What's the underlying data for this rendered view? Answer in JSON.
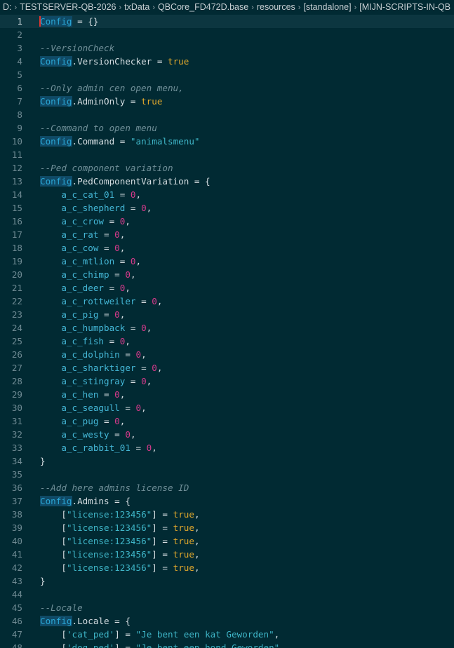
{
  "breadcrumb": [
    "D:",
    "TESTSERVER-QB-2026",
    "txData",
    "QBCore_FD472D.base",
    "resources",
    "[standalone]",
    "[MIJN-SCRIPTS-IN-QB"
  ],
  "editor": {
    "current_line": 1,
    "lines": [
      {
        "n": "1",
        "tokens": [
          [
            "config",
            "Config"
          ],
          [
            "op",
            " = {}"
          ]
        ]
      },
      {
        "n": "2",
        "tokens": []
      },
      {
        "n": "3",
        "tokens": [
          [
            "comment",
            "--VersionCheck"
          ]
        ]
      },
      {
        "n": "4",
        "tokens": [
          [
            "config",
            "Config"
          ],
          [
            "plain",
            ".VersionChecker "
          ],
          [
            "op",
            "= "
          ],
          [
            "bool",
            "true"
          ]
        ]
      },
      {
        "n": "5",
        "tokens": []
      },
      {
        "n": "6",
        "tokens": [
          [
            "comment",
            "--Only admin cen open menu,"
          ]
        ]
      },
      {
        "n": "7",
        "tokens": [
          [
            "config",
            "Config"
          ],
          [
            "plain",
            ".AdminOnly "
          ],
          [
            "op",
            "= "
          ],
          [
            "bool",
            "true"
          ]
        ]
      },
      {
        "n": "8",
        "tokens": []
      },
      {
        "n": "9",
        "tokens": [
          [
            "comment",
            "--Command to open menu"
          ]
        ]
      },
      {
        "n": "10",
        "tokens": [
          [
            "config",
            "Config"
          ],
          [
            "plain",
            ".Command "
          ],
          [
            "op",
            "= "
          ],
          [
            "string",
            "\"animalsmenu\""
          ]
        ]
      },
      {
        "n": "11",
        "tokens": []
      },
      {
        "n": "12",
        "tokens": [
          [
            "comment",
            "--Ped component variation"
          ]
        ]
      },
      {
        "n": "13",
        "tokens": [
          [
            "config",
            "Config"
          ],
          [
            "plain",
            ".PedComponentVariation "
          ],
          [
            "op",
            "= {"
          ]
        ]
      },
      {
        "n": "14",
        "tokens": [
          [
            "plain",
            "    "
          ],
          [
            "key",
            "a_c_cat_01"
          ],
          [
            "op",
            " = "
          ],
          [
            "number",
            "0"
          ],
          [
            "op",
            ","
          ]
        ]
      },
      {
        "n": "15",
        "tokens": [
          [
            "plain",
            "    "
          ],
          [
            "key",
            "a_c_shepherd"
          ],
          [
            "op",
            " = "
          ],
          [
            "number",
            "0"
          ],
          [
            "op",
            ","
          ]
        ]
      },
      {
        "n": "16",
        "tokens": [
          [
            "plain",
            "    "
          ],
          [
            "key",
            "a_c_crow"
          ],
          [
            "op",
            " = "
          ],
          [
            "number",
            "0"
          ],
          [
            "op",
            ","
          ]
        ]
      },
      {
        "n": "17",
        "tokens": [
          [
            "plain",
            "    "
          ],
          [
            "key",
            "a_c_rat"
          ],
          [
            "op",
            " = "
          ],
          [
            "number",
            "0"
          ],
          [
            "op",
            ","
          ]
        ]
      },
      {
        "n": "18",
        "tokens": [
          [
            "plain",
            "    "
          ],
          [
            "key",
            "a_c_cow"
          ],
          [
            "op",
            " = "
          ],
          [
            "number",
            "0"
          ],
          [
            "op",
            ","
          ]
        ]
      },
      {
        "n": "19",
        "tokens": [
          [
            "plain",
            "    "
          ],
          [
            "key",
            "a_c_mtlion"
          ],
          [
            "op",
            " = "
          ],
          [
            "number",
            "0"
          ],
          [
            "op",
            ","
          ]
        ]
      },
      {
        "n": "20",
        "tokens": [
          [
            "plain",
            "    "
          ],
          [
            "key",
            "a_c_chimp"
          ],
          [
            "op",
            " = "
          ],
          [
            "number",
            "0"
          ],
          [
            "op",
            ","
          ]
        ]
      },
      {
        "n": "21",
        "tokens": [
          [
            "plain",
            "    "
          ],
          [
            "key",
            "a_c_deer"
          ],
          [
            "op",
            " = "
          ],
          [
            "number",
            "0"
          ],
          [
            "op",
            ","
          ]
        ]
      },
      {
        "n": "22",
        "tokens": [
          [
            "plain",
            "    "
          ],
          [
            "key",
            "a_c_rottweiler"
          ],
          [
            "op",
            " = "
          ],
          [
            "number",
            "0"
          ],
          [
            "op",
            ","
          ]
        ]
      },
      {
        "n": "23",
        "tokens": [
          [
            "plain",
            "    "
          ],
          [
            "key",
            "a_c_pig"
          ],
          [
            "op",
            " = "
          ],
          [
            "number",
            "0"
          ],
          [
            "op",
            ","
          ]
        ]
      },
      {
        "n": "24",
        "tokens": [
          [
            "plain",
            "    "
          ],
          [
            "key",
            "a_c_humpback"
          ],
          [
            "op",
            " = "
          ],
          [
            "number",
            "0"
          ],
          [
            "op",
            ","
          ]
        ]
      },
      {
        "n": "25",
        "tokens": [
          [
            "plain",
            "    "
          ],
          [
            "key",
            "a_c_fish"
          ],
          [
            "op",
            " = "
          ],
          [
            "number",
            "0"
          ],
          [
            "op",
            ","
          ]
        ]
      },
      {
        "n": "26",
        "tokens": [
          [
            "plain",
            "    "
          ],
          [
            "key",
            "a_c_dolphin"
          ],
          [
            "op",
            " = "
          ],
          [
            "number",
            "0"
          ],
          [
            "op",
            ","
          ]
        ]
      },
      {
        "n": "27",
        "tokens": [
          [
            "plain",
            "    "
          ],
          [
            "key",
            "a_c_sharktiger"
          ],
          [
            "op",
            " = "
          ],
          [
            "number",
            "0"
          ],
          [
            "op",
            ","
          ]
        ]
      },
      {
        "n": "28",
        "tokens": [
          [
            "plain",
            "    "
          ],
          [
            "key",
            "a_c_stingray"
          ],
          [
            "op",
            " = "
          ],
          [
            "number",
            "0"
          ],
          [
            "op",
            ","
          ]
        ]
      },
      {
        "n": "29",
        "tokens": [
          [
            "plain",
            "    "
          ],
          [
            "key",
            "a_c_hen"
          ],
          [
            "op",
            " = "
          ],
          [
            "number",
            "0"
          ],
          [
            "op",
            ","
          ]
        ]
      },
      {
        "n": "30",
        "tokens": [
          [
            "plain",
            "    "
          ],
          [
            "key",
            "a_c_seagull"
          ],
          [
            "op",
            " = "
          ],
          [
            "number",
            "0"
          ],
          [
            "op",
            ","
          ]
        ]
      },
      {
        "n": "31",
        "tokens": [
          [
            "plain",
            "    "
          ],
          [
            "key",
            "a_c_pug"
          ],
          [
            "op",
            " = "
          ],
          [
            "number",
            "0"
          ],
          [
            "op",
            ","
          ]
        ]
      },
      {
        "n": "32",
        "tokens": [
          [
            "plain",
            "    "
          ],
          [
            "key",
            "a_c_westy"
          ],
          [
            "op",
            " = "
          ],
          [
            "number",
            "0"
          ],
          [
            "op",
            ","
          ]
        ]
      },
      {
        "n": "33",
        "tokens": [
          [
            "plain",
            "    "
          ],
          [
            "key",
            "a_c_rabbit_01"
          ],
          [
            "op",
            " = "
          ],
          [
            "number",
            "0"
          ],
          [
            "op",
            ","
          ]
        ]
      },
      {
        "n": "34",
        "tokens": [
          [
            "op",
            "}"
          ]
        ]
      },
      {
        "n": "35",
        "tokens": []
      },
      {
        "n": "36",
        "tokens": [
          [
            "comment",
            "--Add here admins license ID"
          ]
        ]
      },
      {
        "n": "37",
        "tokens": [
          [
            "config",
            "Config"
          ],
          [
            "plain",
            ".Admins "
          ],
          [
            "op",
            "= {"
          ]
        ]
      },
      {
        "n": "38",
        "tokens": [
          [
            "plain",
            "    "
          ],
          [
            "op",
            "["
          ],
          [
            "string",
            "\"license:123456\""
          ],
          [
            "op",
            "] = "
          ],
          [
            "bool",
            "true"
          ],
          [
            "op",
            ","
          ]
        ]
      },
      {
        "n": "39",
        "tokens": [
          [
            "plain",
            "    "
          ],
          [
            "op",
            "["
          ],
          [
            "string",
            "\"license:123456\""
          ],
          [
            "op",
            "] = "
          ],
          [
            "bool",
            "true"
          ],
          [
            "op",
            ","
          ]
        ]
      },
      {
        "n": "40",
        "tokens": [
          [
            "plain",
            "    "
          ],
          [
            "op",
            "["
          ],
          [
            "string",
            "\"license:123456\""
          ],
          [
            "op",
            "] = "
          ],
          [
            "bool",
            "true"
          ],
          [
            "op",
            ","
          ]
        ]
      },
      {
        "n": "41",
        "tokens": [
          [
            "plain",
            "    "
          ],
          [
            "op",
            "["
          ],
          [
            "string",
            "\"license:123456\""
          ],
          [
            "op",
            "] = "
          ],
          [
            "bool",
            "true"
          ],
          [
            "op",
            ","
          ]
        ]
      },
      {
        "n": "42",
        "tokens": [
          [
            "plain",
            "    "
          ],
          [
            "op",
            "["
          ],
          [
            "string",
            "\"license:123456\""
          ],
          [
            "op",
            "] = "
          ],
          [
            "bool",
            "true"
          ],
          [
            "op",
            ","
          ]
        ]
      },
      {
        "n": "43",
        "tokens": [
          [
            "op",
            "}"
          ]
        ]
      },
      {
        "n": "44",
        "tokens": []
      },
      {
        "n": "45",
        "tokens": [
          [
            "comment",
            "--Locale"
          ]
        ]
      },
      {
        "n": "46",
        "tokens": [
          [
            "config",
            "Config"
          ],
          [
            "plain",
            ".Locale "
          ],
          [
            "op",
            "= {"
          ]
        ]
      },
      {
        "n": "47",
        "tokens": [
          [
            "plain",
            "    "
          ],
          [
            "op",
            "["
          ],
          [
            "string",
            "'cat_ped'"
          ],
          [
            "op",
            "] = "
          ],
          [
            "string",
            "\"Je bent een kat Geworden\""
          ],
          [
            "op",
            ","
          ]
        ]
      },
      {
        "n": "48",
        "tokens": [
          [
            "plain",
            "    "
          ],
          [
            "op",
            "["
          ],
          [
            "string",
            "'dog_ped'"
          ],
          [
            "op",
            "] = "
          ],
          [
            "string",
            "\"Je bent een hond Geworden\""
          ],
          [
            "op",
            ","
          ]
        ]
      }
    ]
  }
}
